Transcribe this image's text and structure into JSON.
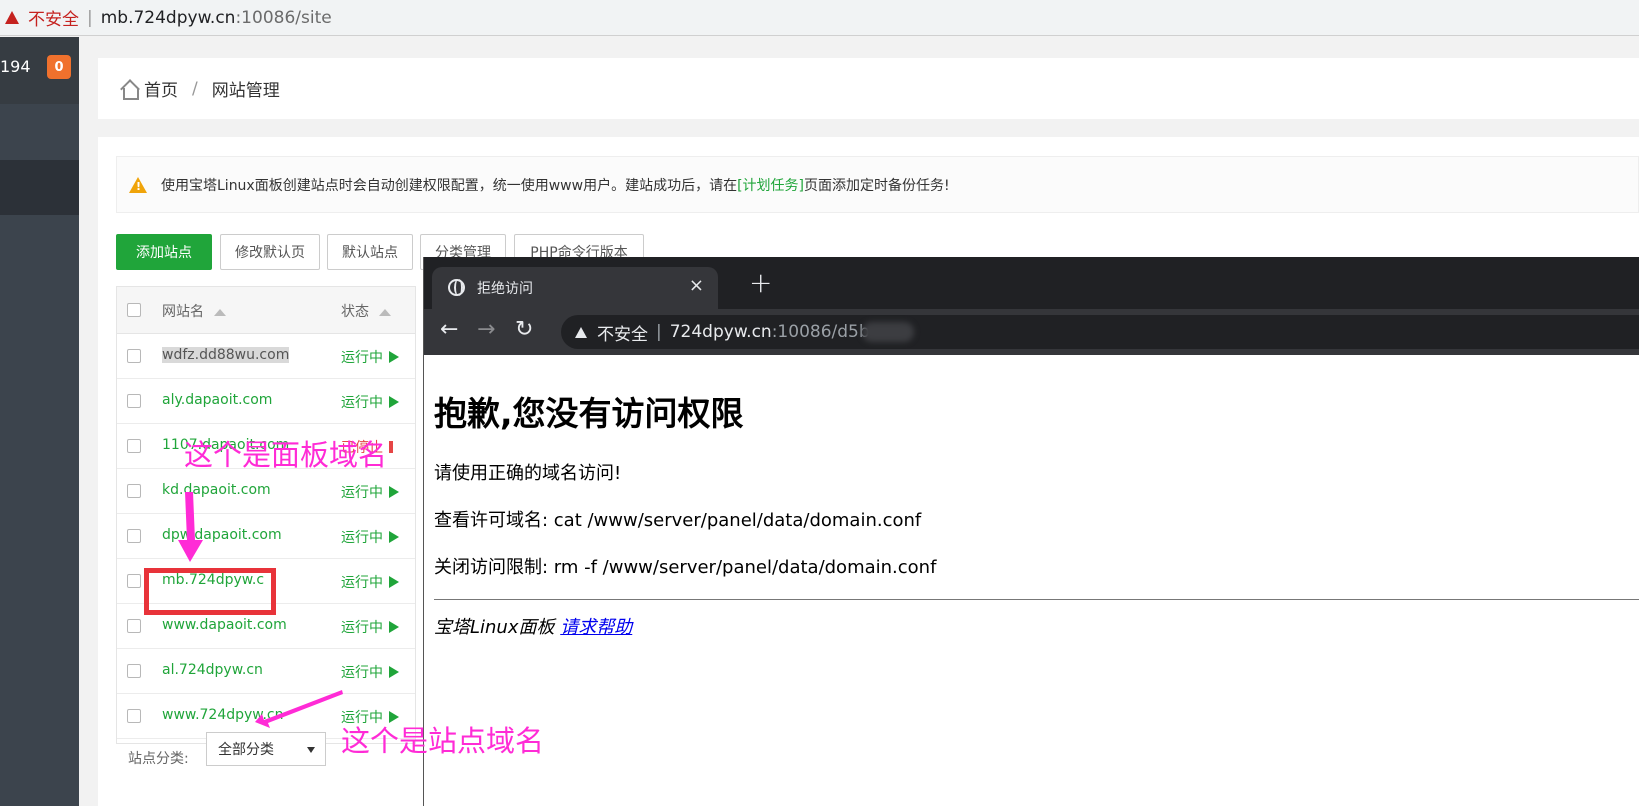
{
  "address_bar": {
    "insecure_label": "不安全",
    "separator": "|",
    "host": "mb.724dpyw.cn",
    "path": ":10086/site"
  },
  "sidebar": {
    "count": "194",
    "badge": "0"
  },
  "breadcrumb": {
    "home": "首页",
    "separator": "/",
    "current": "网站管理"
  },
  "notice": {
    "text_before": "使用宝塔Linux面板创建站点时会自动创建权限配置，统一使用www用户。建站成功后，请在",
    "link": "[计划任务]",
    "text_after": "页面添加定时备份任务!"
  },
  "toolbar": {
    "add_site": "添加站点",
    "edit_default_page": "修改默认页",
    "default_site": "默认站点",
    "category_manage": "分类管理",
    "php_cli_version": "PHP命令行版本"
  },
  "table": {
    "header_name": "网站名",
    "header_status": "状态",
    "rows": [
      {
        "name": "wdfz.dd88wu.com",
        "status": "运行中"
      },
      {
        "name": "aly.dapaoit.com",
        "status": "运行中"
      },
      {
        "name": "1107.dapaoit.com",
        "status": "已停止"
      },
      {
        "name": "kd.dapaoit.com",
        "status": "运行中"
      },
      {
        "name": "dpw.dapaoit.com",
        "status": "运行中"
      },
      {
        "name": "mb.724dpyw.c",
        "status": "运行中"
      },
      {
        "name": "www.dapaoit.com",
        "status": "运行中"
      },
      {
        "name": "al.724dpyw.cn",
        "status": "运行中"
      },
      {
        "name": "www.724dpyw.cn",
        "status": "运行中"
      }
    ]
  },
  "filter": {
    "label": "站点分类:",
    "selected": "全部分类"
  },
  "overlay_browser": {
    "tab_title": "拒绝访问",
    "tab_close": "×",
    "new_tab": "+",
    "back": "←",
    "forward": "→",
    "reload": "↻",
    "insecure_label": "不安全",
    "separator": "|",
    "host": "724dpyw.cn",
    "path": ":10086/d5b",
    "heading": "抱歉,您没有访问权限",
    "line1": "请使用正确的域名访问!",
    "line2": "查看许可域名: cat /www/server/panel/data/domain.conf",
    "line3": "关闭访问限制: rm -f /www/server/panel/data/domain.conf",
    "footer_text": "宝塔Linux面板",
    "footer_link": "请求帮助"
  },
  "annotations": {
    "panel_domain": "这个是面板域名",
    "site_domain": "这个是站点域名"
  },
  "colors": {
    "accent_green": "#20a53a",
    "annotation_magenta": "#ff2bd6",
    "highlight_red": "#e8333a"
  }
}
